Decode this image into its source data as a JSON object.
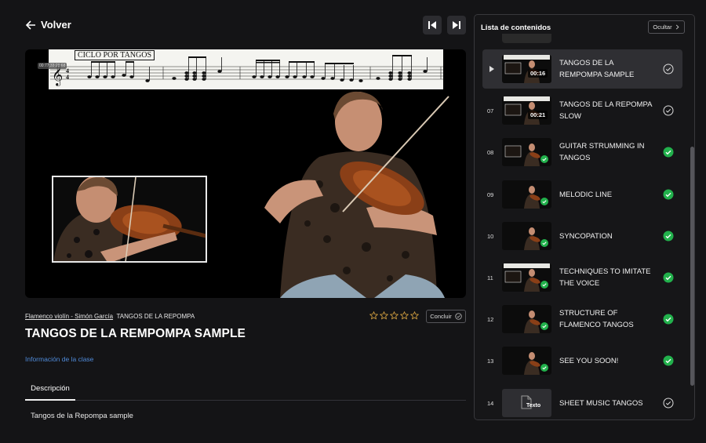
{
  "header": {
    "back_label": "Volver"
  },
  "video": {
    "sheet_title": "CICLO POR TANGOS",
    "timestamp": "00:77:33:28:68"
  },
  "lesson": {
    "course_link": "Flamenco violín - Simón García",
    "module": "TANGOS DE LA REPOMPA",
    "title": "TANGOS DE LA REMPOMPA SAMPLE",
    "info_link": "Información de la clase",
    "complete_label": "Concluir",
    "rating": 0,
    "rating_max": 5
  },
  "tabs": [
    {
      "label": "Descripción",
      "active": true
    }
  ],
  "description": "Tangos de la Repompa sample",
  "sidebar": {
    "title": "Lista de contenidos",
    "hide_label": "Ocultar",
    "items": [
      {
        "num": "",
        "title": "TANGOS DE LA REMPOMPA SAMPLE",
        "duration": "00:16",
        "active": true,
        "completed": false,
        "type": "video"
      },
      {
        "num": "07",
        "title": "TANGOS DE LA REPOMPA SLOW",
        "duration": "00:21",
        "active": false,
        "completed": false,
        "type": "video"
      },
      {
        "num": "08",
        "title": "GUITAR STRUMMING IN TANGOS",
        "duration": "",
        "active": false,
        "completed": true,
        "type": "video"
      },
      {
        "num": "09",
        "title": "MELODIC LINE",
        "duration": "",
        "active": false,
        "completed": true,
        "type": "video"
      },
      {
        "num": "10",
        "title": "SYNCOPATION",
        "duration": "",
        "active": false,
        "completed": true,
        "type": "video"
      },
      {
        "num": "11",
        "title": "TECHNIQUES TO IMITATE THE VOICE",
        "duration": "",
        "active": false,
        "completed": true,
        "type": "video"
      },
      {
        "num": "12",
        "title": "STRUCTURE OF FLAMENCO TANGOS",
        "duration": "",
        "active": false,
        "completed": true,
        "type": "video"
      },
      {
        "num": "13",
        "title": "SEE YOU SOON!",
        "duration": "",
        "active": false,
        "completed": true,
        "type": "video"
      },
      {
        "num": "14",
        "title": "SHEET MUSIC TANGOS",
        "duration": "",
        "active": false,
        "completed": false,
        "type": "text",
        "thumb_label": "Texto"
      }
    ]
  },
  "colors": {
    "accent_green": "#22b14c",
    "link_blue": "#4f8ad8",
    "star_gold": "#d9a441"
  }
}
